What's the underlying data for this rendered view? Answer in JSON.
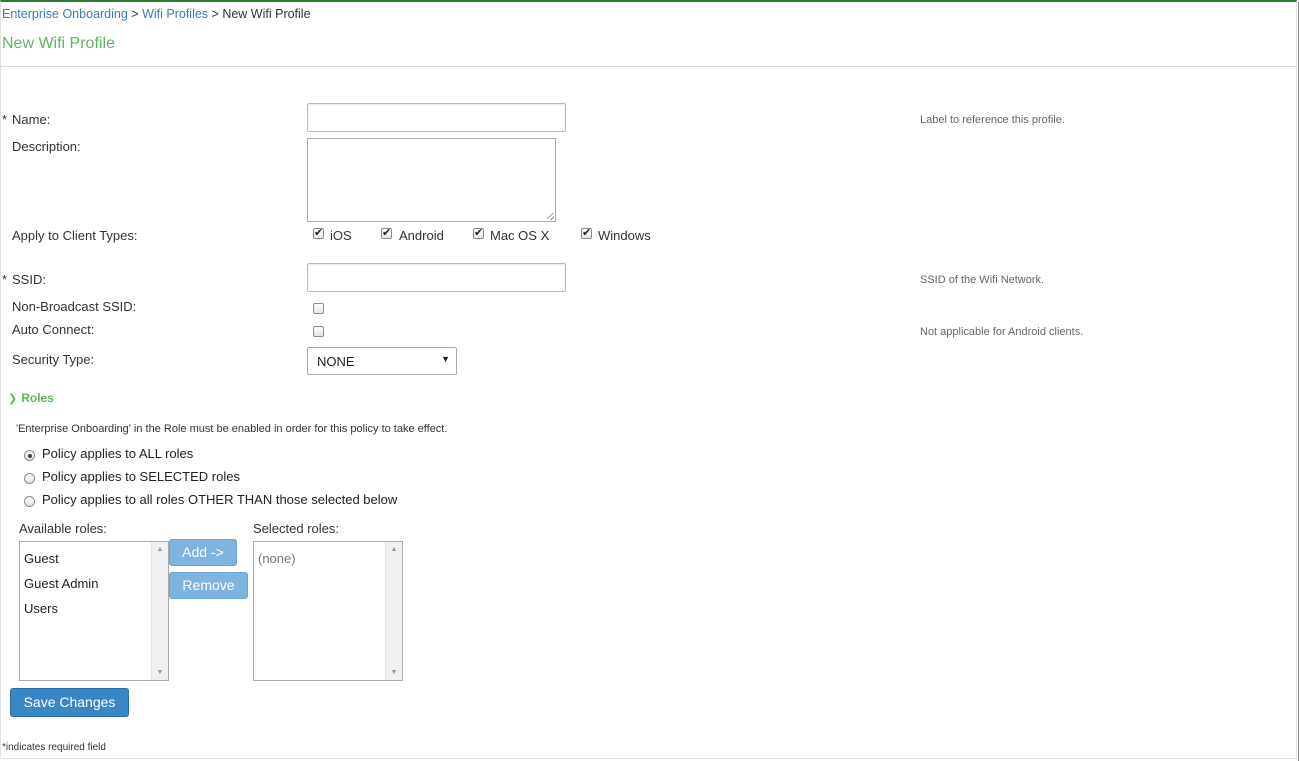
{
  "breadcrumb": {
    "items": [
      "Enterprise Onboarding",
      "Wifi Profiles"
    ],
    "sep": ">",
    "current": "New Wifi Profile"
  },
  "page": {
    "title": "New Wifi Profile"
  },
  "form": {
    "required_mark": "*",
    "name": {
      "label": "Name:",
      "value": "",
      "hint": "Label to reference this profile."
    },
    "description": {
      "label": "Description:",
      "value": ""
    },
    "client_types": {
      "label": "Apply to Client Types:",
      "options": [
        {
          "label": "iOS",
          "checked": true
        },
        {
          "label": "Android",
          "checked": true
        },
        {
          "label": "Mac OS X",
          "checked": true
        },
        {
          "label": "Windows",
          "checked": true
        }
      ]
    },
    "ssid": {
      "label": "SSID:",
      "value": "",
      "hint": "SSID of the Wifi Network."
    },
    "non_broadcast": {
      "label": "Non-Broadcast SSID:",
      "checked": false
    },
    "auto_connect": {
      "label": "Auto Connect:",
      "checked": false,
      "hint": "Not applicable for Android clients."
    },
    "security_type": {
      "label": "Security Type:",
      "value": "NONE"
    }
  },
  "roles": {
    "heading": "Roles",
    "note": "'Enterprise Onboarding' in the Role must be enabled in order for this policy to take effect.",
    "policy_options": [
      {
        "label": "Policy applies to ALL roles",
        "selected": true
      },
      {
        "label": "Policy applies to SELECTED roles",
        "selected": false
      },
      {
        "label": "Policy applies to all roles OTHER THAN those selected below",
        "selected": false
      }
    ],
    "available_label": "Available roles:",
    "available": [
      "Guest",
      "Guest Admin",
      "Users"
    ],
    "selected_label": "Selected roles:",
    "selected_empty": "(none)",
    "add_button": "Add ->",
    "remove_button": "Remove"
  },
  "actions": {
    "save": "Save Changes"
  },
  "footer": {
    "required_note": "*indicates required field"
  }
}
